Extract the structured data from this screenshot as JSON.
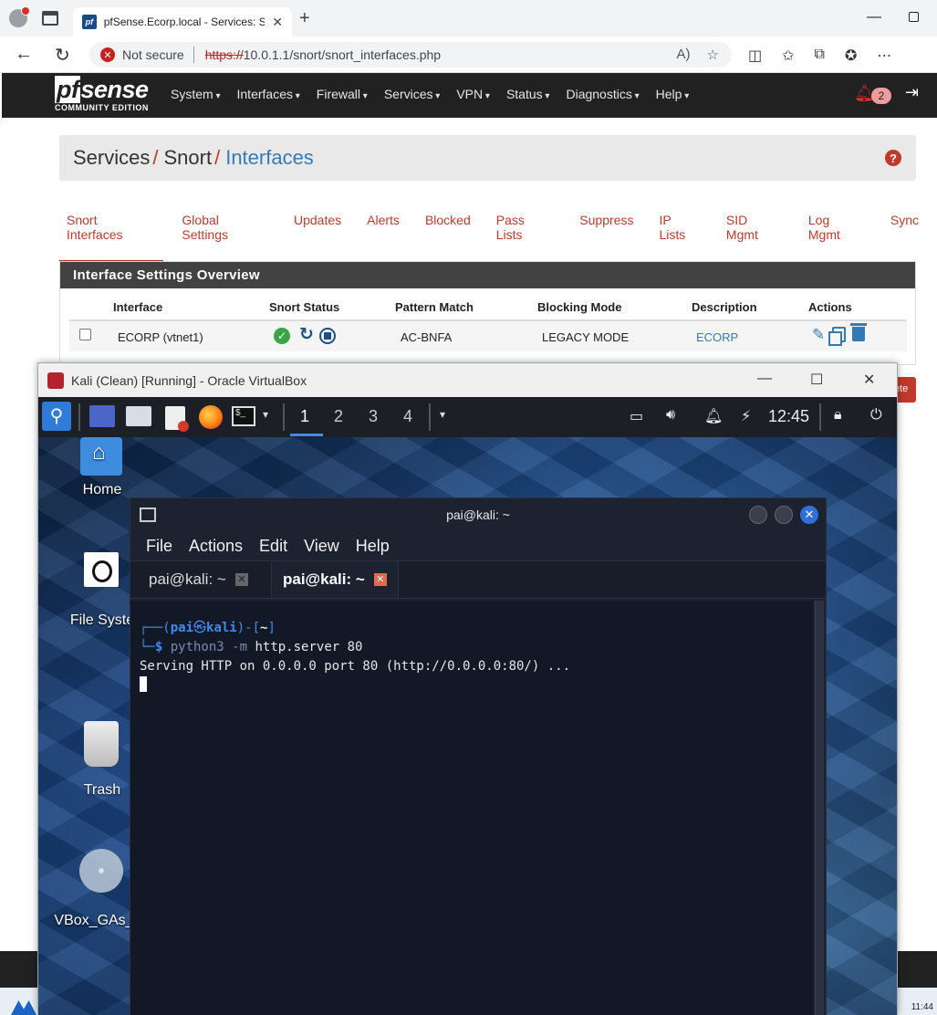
{
  "browser": {
    "tab_title": "pfSense.Ecorp.local - Services: Sn",
    "favicon_text": "pf",
    "not_secure": "Not secure",
    "url_scheme": "https://",
    "url_rest": "10.0.1.1/snort/snort_interfaces.php"
  },
  "pfsense": {
    "logo_word_box": "pf",
    "logo_word_rest": "sense",
    "logo_edition": "COMMUNITY EDITION",
    "menu": [
      "System",
      "Interfaces",
      "Firewall",
      "Services",
      "VPN",
      "Status",
      "Diagnostics",
      "Help"
    ],
    "notification_count": "2",
    "breadcrumb": [
      "Services",
      "Snort",
      "Interfaces"
    ],
    "breadcrumb_sep": "/",
    "help_icon": "?",
    "tabs": [
      "Snort Interfaces",
      "Global Settings",
      "Updates",
      "Alerts",
      "Blocked",
      "Pass Lists",
      "Suppress",
      "IP Lists",
      "SID Mgmt",
      "Log Mgmt",
      "Sync"
    ],
    "panel_title": "Interface Settings Overview",
    "columns": [
      "Interface",
      "Snort Status",
      "Pattern Match",
      "Blocking Mode",
      "Description",
      "Actions"
    ],
    "row": {
      "interface": "ECORP (vtnet1)",
      "pattern_match": "AC-BNFA",
      "blocking_mode": "LEGACY MODE",
      "description": "ECORP"
    },
    "delete_btn_partial": "ete"
  },
  "vbox": {
    "title": "Kali (Clean) [Running] - Oracle VirtualBox"
  },
  "kali": {
    "workspaces": [
      "1",
      "2",
      "3",
      "4"
    ],
    "clock": "12:45",
    "desktop_icons": [
      "Home",
      "File Syste",
      "Trash",
      "VBox_GAs_"
    ]
  },
  "terminal": {
    "title": "pai@kali: ~",
    "menu": [
      "File",
      "Actions",
      "Edit",
      "View",
      "Help"
    ],
    "tabs": [
      "pai@kali: ~",
      "pai@kali: ~"
    ],
    "prompt_user": "pai",
    "prompt_at": "㉿",
    "prompt_host": "kali",
    "prompt_dir": "~",
    "cmd_name": "python3",
    "cmd_flag": "-m",
    "cmd_args": "http.server 80",
    "output": "Serving HTTP on 0.0.0.0 port 80 (http://0.0.0.0:80/) ..."
  },
  "host_taskbar": {
    "clock": "11:44"
  }
}
